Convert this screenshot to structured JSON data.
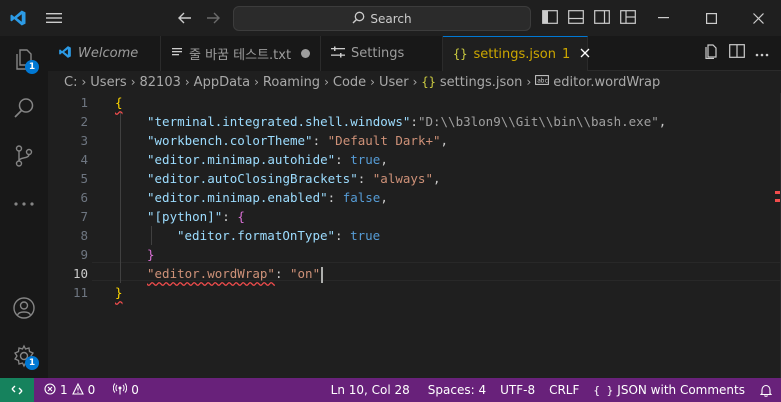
{
  "titlebar": {
    "search_label": "Search",
    "icons": [
      "vscode-logo-icon",
      "hamburger-menu-icon",
      "back-arrow-icon",
      "forward-arrow-icon",
      "search-icon",
      "toggle-primary-sidebar-icon",
      "toggle-panel-icon",
      "toggle-secondary-sidebar-icon",
      "customize-layout-icon",
      "minimize-icon",
      "maximize-icon",
      "close-icon"
    ]
  },
  "activitybar": {
    "explorer_badge": "1",
    "manage_badge": "1"
  },
  "tabs": [
    {
      "label": "Welcome",
      "icon": "vscode-logo-icon"
    },
    {
      "label": "줄 바꿈 테스트.txt",
      "icon": "text-file-icon"
    },
    {
      "label": "Settings",
      "icon": "settings-icon"
    },
    {
      "label": "settings.json",
      "problems": "1",
      "icon": "json-icon"
    }
  ],
  "breadcrumb": {
    "items": [
      "C:",
      "Users",
      "82103",
      "AppData",
      "Roaming",
      "Code",
      "User",
      "settings.json",
      "editor.wordWrap"
    ]
  },
  "editor": {
    "line_numbers": [
      "1",
      "2",
      "3",
      "4",
      "5",
      "6",
      "7",
      "8",
      "9",
      "10",
      "11"
    ],
    "lines": {
      "l1": "{",
      "l2_key": "\"terminal.integrated.shell.windows\"",
      "l2_colon": ":",
      "l2_val": "\"D:\\\\b3lon9\\\\Git\\\\bin\\\\bash.exe\"",
      "l2_end": ",",
      "l3_key": "\"workbench.colorTheme\"",
      "l3_colon": ": ",
      "l3_val": "\"Default Dark+\"",
      "l3_end": ",",
      "l4_key": "\"editor.minimap.autohide\"",
      "l4_colon": ": ",
      "l4_val": "true",
      "l4_end": ",",
      "l5_key": "\"editor.autoClosingBrackets\"",
      "l5_colon": ": ",
      "l5_val": "\"always\"",
      "l5_end": ",",
      "l6_key": "\"editor.minimap.enabled\"",
      "l6_colon": ": ",
      "l6_val": "false",
      "l6_end": ",",
      "l7_key": "\"[python]\"",
      "l7_colon": ": ",
      "l7_val": "{",
      "l8_key": "\"editor.formatOnType\"",
      "l8_colon": ": ",
      "l8_val": "true",
      "l9": "}",
      "l10_key": "\"editor.wordWrap\"",
      "l10_colon": ": ",
      "l10_val": "\"on\"",
      "l11": "}"
    }
  },
  "statusbar": {
    "errors": "1",
    "warnings": "0",
    "ports": "0",
    "position": "Ln 10, Col 28",
    "spaces": "Spaces: 4",
    "encoding": "UTF-8",
    "eol": "CRLF",
    "language": "JSON with Comments",
    "language_prefix": "{ }"
  },
  "colors": {
    "statusbar": "#68217a",
    "remote": "#16825d",
    "accent": "#0078d4",
    "tab_dirty_warning": "#cca700"
  }
}
